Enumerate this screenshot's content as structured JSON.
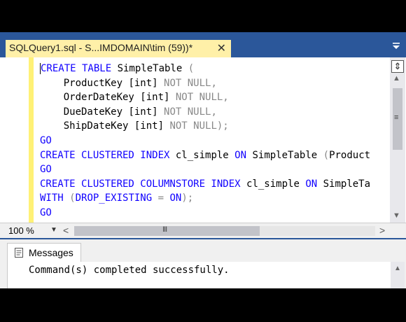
{
  "tab": {
    "title": "SQLQuery1.sql - S...IMDOMAIN\\tim (59))*",
    "close_glyph": "✕"
  },
  "editor": {
    "lines": [
      [
        {
          "t": "CREATE TABLE ",
          "c": "kw"
        },
        {
          "t": "SimpleTable ",
          "c": ""
        },
        {
          "t": "(",
          "c": "gr"
        }
      ],
      [
        {
          "t": "    ProductKey ",
          "c": ""
        },
        {
          "t": "[int] ",
          "c": ""
        },
        {
          "t": "NOT NULL,",
          "c": "gr"
        }
      ],
      [
        {
          "t": "    OrderDateKey ",
          "c": ""
        },
        {
          "t": "[int] ",
          "c": ""
        },
        {
          "t": "NOT NULL,",
          "c": "gr"
        }
      ],
      [
        {
          "t": "    DueDateKey ",
          "c": ""
        },
        {
          "t": "[int] ",
          "c": ""
        },
        {
          "t": "NOT NULL,",
          "c": "gr"
        }
      ],
      [
        {
          "t": "    ShipDateKey ",
          "c": ""
        },
        {
          "t": "[int] ",
          "c": ""
        },
        {
          "t": "NOT NULL);",
          "c": "gr"
        }
      ],
      [
        {
          "t": "GO",
          "c": "kw"
        }
      ],
      [
        {
          "t": "CREATE CLUSTERED INDEX ",
          "c": "kw"
        },
        {
          "t": "cl_simple ",
          "c": ""
        },
        {
          "t": "ON ",
          "c": "kw"
        },
        {
          "t": "SimpleTable ",
          "c": ""
        },
        {
          "t": "(",
          "c": "gr"
        },
        {
          "t": "Product",
          "c": ""
        }
      ],
      [
        {
          "t": "GO",
          "c": "kw"
        }
      ],
      [
        {
          "t": "CREATE CLUSTERED COLUMNSTORE INDEX ",
          "c": "kw"
        },
        {
          "t": "cl_simple ",
          "c": ""
        },
        {
          "t": "ON ",
          "c": "kw"
        },
        {
          "t": "SimpleTa",
          "c": ""
        }
      ],
      [
        {
          "t": "WITH ",
          "c": "kw"
        },
        {
          "t": "(",
          "c": "gr"
        },
        {
          "t": "DROP_EXISTING ",
          "c": "kw"
        },
        {
          "t": "= ",
          "c": "gr"
        },
        {
          "t": "ON",
          "c": "kw"
        },
        {
          "t": ");",
          "c": "gr"
        }
      ],
      [
        {
          "t": "GO",
          "c": "kw"
        }
      ]
    ]
  },
  "scrollbar": {
    "split_glyph": "⇕",
    "up_glyph": "▲",
    "down_glyph": "▼",
    "grip_glyph": "≡"
  },
  "zoom": {
    "value": "100 %",
    "dropdown_glyph": "▼",
    "left_glyph": "<",
    "right_glyph": ">",
    "grip_glyph": "III"
  },
  "results": {
    "tab_label": "Messages",
    "message": "Command(s) completed successfully."
  },
  "colors": {
    "chrome": "#2b579a",
    "active_tab": "#fff0a8",
    "keyword": "#1000ff",
    "operator": "#888888",
    "change_marker": "#fff176"
  }
}
